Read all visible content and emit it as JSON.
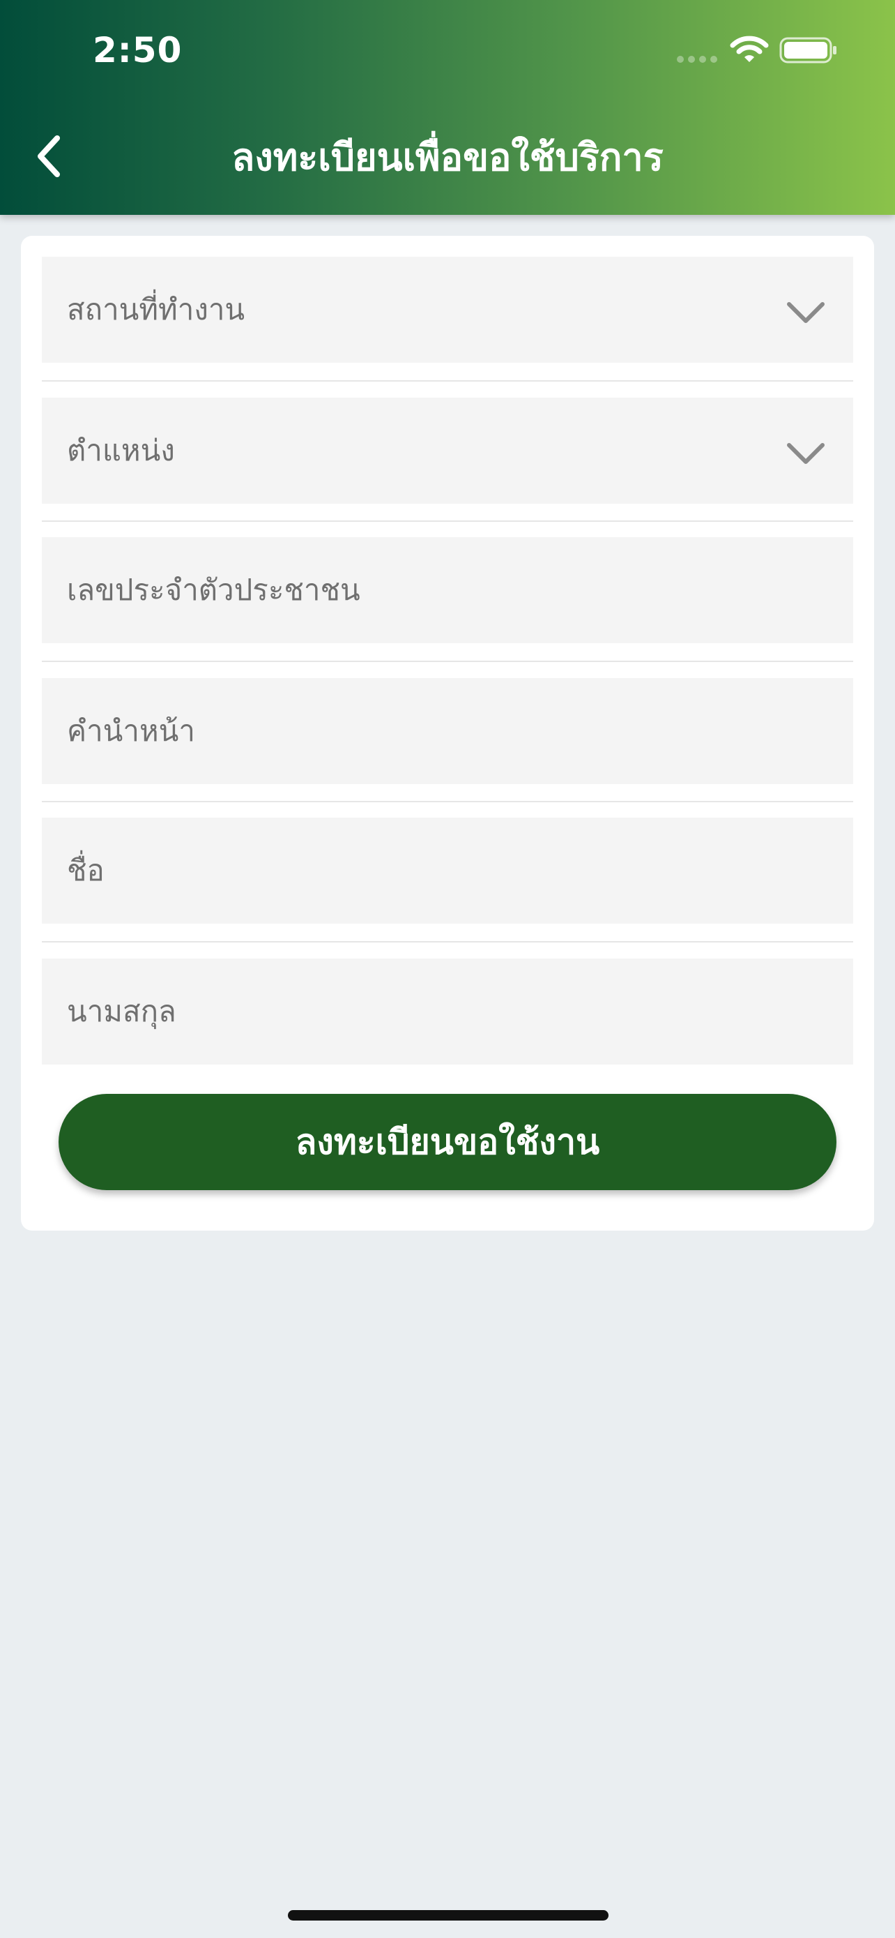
{
  "status_bar": {
    "time": "2:50",
    "wifi_icon": "wifi-icon",
    "battery_icon": "battery-icon"
  },
  "header": {
    "back_icon": "chevron-left-icon",
    "title": "ลงทะเบียนเพื่อขอใช้บริการ",
    "gradient": [
      "#024d3a",
      "#8bc34a"
    ]
  },
  "form": {
    "fields": [
      {
        "label": "สถานที่ทำงาน",
        "type": "select",
        "icon": "chevron-down-icon"
      },
      {
        "label": "ตำแหน่ง",
        "type": "select",
        "icon": "chevron-down-icon"
      },
      {
        "label": "เลขประจำตัวประชาชน",
        "type": "text"
      },
      {
        "label": "คำนำหน้า",
        "type": "text"
      },
      {
        "label": "ชื่อ",
        "type": "text"
      },
      {
        "label": "นามสกุล",
        "type": "text"
      }
    ],
    "submit_label": "ลงทะเบียนขอใช้งาน",
    "submit_color": "#1f5e22"
  },
  "colors": {
    "background": "#eaeef1",
    "card": "#ffffff",
    "field_background": "#f4f4f4",
    "placeholder_text": "#6f6f6f"
  }
}
